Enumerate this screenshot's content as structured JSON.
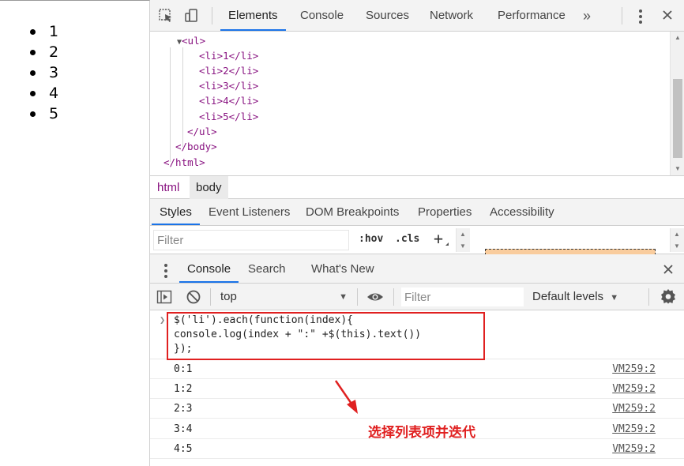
{
  "page_preview": {
    "list_items": [
      "1",
      "2",
      "3",
      "4",
      "5"
    ]
  },
  "devtools": {
    "main_tabs": [
      {
        "label": "Elements",
        "active": true
      },
      {
        "label": "Console",
        "active": false
      },
      {
        "label": "Sources",
        "active": false
      },
      {
        "label": "Network",
        "active": false
      },
      {
        "label": "Performance",
        "active": false
      }
    ],
    "more_tabs_label": "»",
    "elements_tree": {
      "ul_open": "<ul>",
      "li_items": [
        "<li>1</li>",
        "<li>2</li>",
        "<li>3</li>",
        "<li>4</li>",
        "<li>5</li>"
      ],
      "ul_close": "</ul>",
      "body_close": "</body>",
      "html_close": "</html>"
    },
    "breadcrumbs": [
      "html",
      "body"
    ],
    "sub_tabs": [
      {
        "label": "Styles",
        "active": true
      },
      {
        "label": "Event Listeners",
        "active": false
      },
      {
        "label": "DOM Breakpoints",
        "active": false
      },
      {
        "label": "Properties",
        "active": false
      },
      {
        "label": "Accessibility",
        "active": false
      }
    ],
    "styles": {
      "filter_placeholder": "Filter",
      "hov_label": ":hov",
      "cls_label": ".cls",
      "add_label": "+"
    },
    "drawer_tabs": [
      {
        "label": "Console",
        "active": true
      },
      {
        "label": "Search",
        "active": false
      },
      {
        "label": "What's New",
        "active": false
      }
    ],
    "console_toolbar": {
      "context": "top",
      "filter_placeholder": "Filter",
      "levels": "Default levels"
    },
    "console": {
      "command_lines": [
        "$('li').each(function(index){",
        "console.log(index + \":\" +$(this).text())",
        "});"
      ],
      "outputs": [
        {
          "text": "0:1",
          "source": "VM259:2"
        },
        {
          "text": "1:2",
          "source": "VM259:2"
        },
        {
          "text": "2:3",
          "source": "VM259:2"
        },
        {
          "text": "3:4",
          "source": "VM259:2"
        },
        {
          "text": "4:5",
          "source": "VM259:2"
        }
      ]
    }
  },
  "annotation": {
    "text": "选择列表项并迭代",
    "color": "#e02020"
  },
  "colors": {
    "tag": "#881280",
    "accent": "#1a73e8",
    "highlight": "#e02020"
  }
}
